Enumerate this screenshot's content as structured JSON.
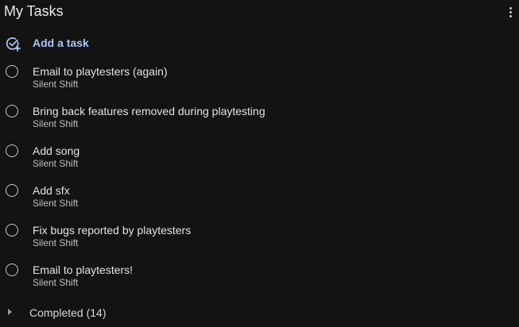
{
  "header": {
    "title": "My Tasks",
    "menu_icon": "more-vert-icon"
  },
  "add_task": {
    "label": "Add a task",
    "icon": "add-task-icon",
    "color": "#a8c7fa"
  },
  "tasks": [
    {
      "title": "Email to playtesters (again)",
      "list": "Silent Shift"
    },
    {
      "title": "Bring back features removed during playtesting",
      "list": "Silent Shift"
    },
    {
      "title": "Add song",
      "list": "Silent Shift"
    },
    {
      "title": "Add sfx",
      "list": "Silent Shift"
    },
    {
      "title": "Fix bugs reported by playtesters",
      "list": "Silent Shift"
    },
    {
      "title": "Email to playtesters!",
      "list": "Silent Shift"
    }
  ],
  "completed": {
    "label": "Completed (14)",
    "icon": "chevron-right-icon"
  },
  "colors": {
    "background": "#131313",
    "text": "#e3e3e3",
    "accent": "#a8c7fa"
  }
}
